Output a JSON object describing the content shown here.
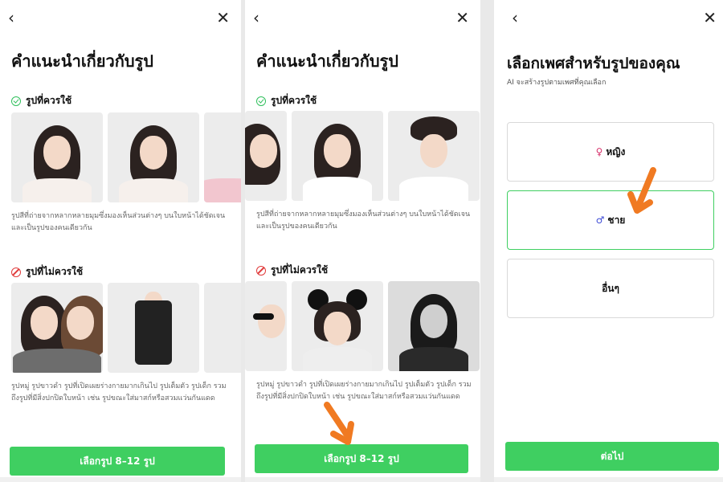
{
  "panel1": {
    "title": "คำแนะนำเกี่ยวกับรูป",
    "good_label": "รูปที่ควรใช้",
    "good_desc": "รูปสีที่ถ่ายจากหลากหลายมุมซึ่งมองเห็นส่วนต่างๆ บนใบหน้าได้ชัดเจน และเป็นรูปของคนเดียวกัน",
    "bad_label": "รูปที่ไม่ควรใช้",
    "bad_desc": "รูปหมู่ รูปขาวดำ รูปที่เปิดเผยร่างกายมากเกินไป รูปเต็มตัว รูปเด็ก รวมถึงรูปที่มีสิ่งปกปิดใบหน้า เช่น รูปขณะใส่มาสก์หรือสวมแว่นกันแดด",
    "button": "เลือกรูป 8–12 รูป"
  },
  "panel2": {
    "title": "คำแนะนำเกี่ยวกับรูป",
    "good_label": "รูปที่ควรใช้",
    "good_desc": "รูปสีที่ถ่ายจากหลากหลายมุมซึ่งมองเห็นส่วนต่างๆ บนใบหน้าได้ชัดเจน และเป็นรูปของคนเดียวกัน",
    "bad_label": "รูปที่ไม่ควรใช้",
    "bad_desc": "รูปหมู่ รูปขาวดำ รูปที่เปิดเผยร่างกายมากเกินไป รูปเต็มตัว รูปเด็ก รวมถึงรูปที่มีสิ่งปกปิดใบหน้า เช่น รูปขณะใส่มาสก์หรือสวมแว่นกันแดด",
    "button": "เลือกรูป 8–12 รูป"
  },
  "panel3": {
    "title": "เลือกเพศสำหรับรูปของคุณ",
    "subtitle": "AI จะสร้างรูปตามเพศที่คุณเลือก",
    "options": [
      {
        "symbol": "♀",
        "label": "หญิง"
      },
      {
        "symbol": "♂",
        "label": "ชาย"
      },
      {
        "label": "อื่นๆ"
      }
    ],
    "selected": "ชาย",
    "button": "ต่อไป"
  },
  "icons": {
    "back": "chevron-left-icon",
    "close": "close-icon",
    "good": "check-circle-icon",
    "bad": "prohibited-icon",
    "annotation": "orange-arrow-icon"
  },
  "colors": {
    "accent": "#3fcf61",
    "good": "#2fbf5b",
    "bad": "#e03b3b",
    "annotation": "#f07a22"
  }
}
